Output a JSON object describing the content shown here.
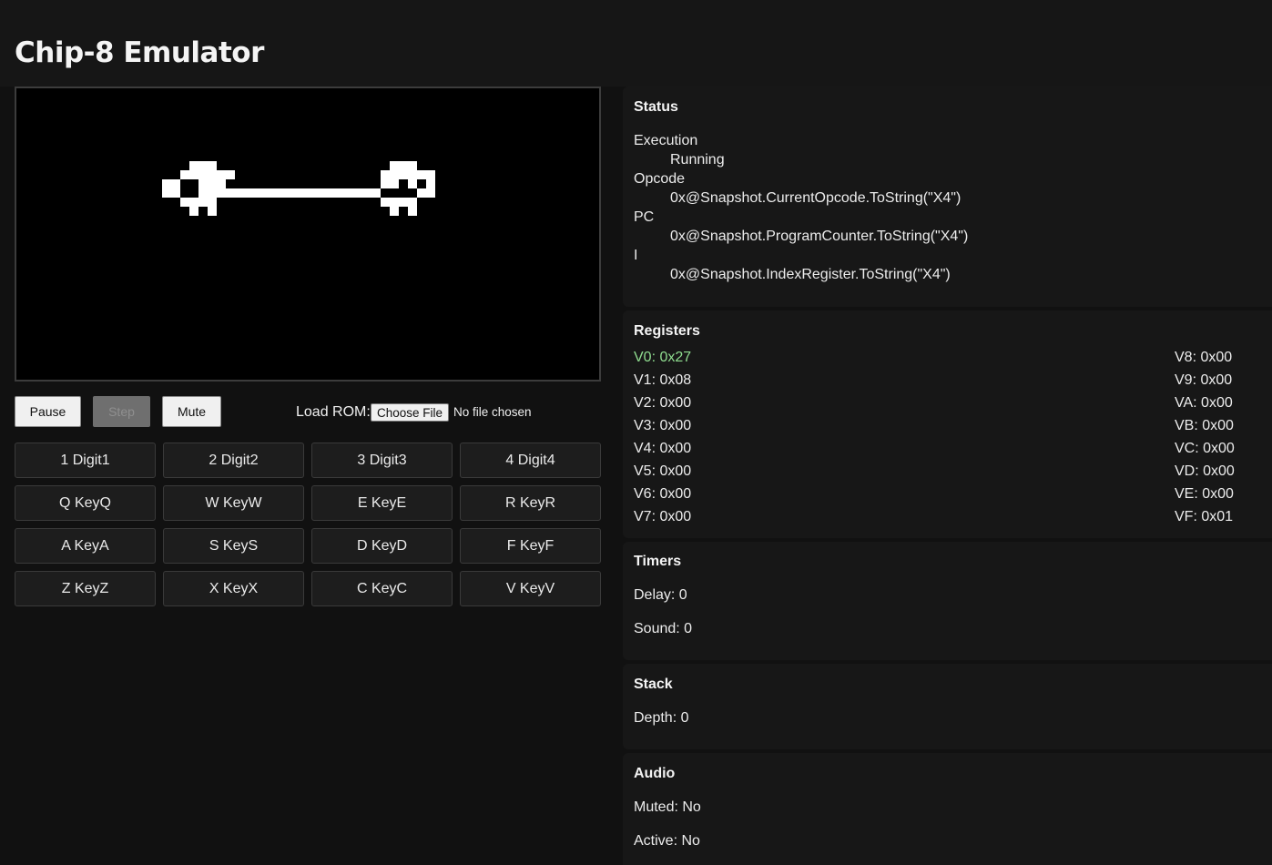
{
  "page": {
    "title": "Chip-8 Emulator"
  },
  "controls": {
    "pause_label": "Pause",
    "step_label": "Step",
    "mute_label": "Mute",
    "load_rom_label": "Load ROM:",
    "choose_file_label": "Choose File",
    "file_status": "No file chosen"
  },
  "keypad": [
    [
      "1 Digit1",
      "2 Digit2",
      "3 Digit3",
      "4 Digit4"
    ],
    [
      "Q KeyQ",
      "W KeyW",
      "E KeyE",
      "R KeyR"
    ],
    [
      "A KeyA",
      "S KeyS",
      "D KeyD",
      "F KeyF"
    ],
    [
      "Z KeyZ",
      "X KeyX",
      "C KeyC",
      "V KeyV"
    ]
  ],
  "status": {
    "title": "Status",
    "execution_label": "Execution",
    "execution_value": "Running",
    "opcode_label": "Opcode",
    "opcode_value": "0x@Snapshot.CurrentOpcode.ToString(\"X4\")",
    "pc_label": "PC",
    "pc_value": "0x@Snapshot.ProgramCounter.ToString(\"X4\")",
    "i_label": "I",
    "i_value": "0x@Snapshot.IndexRegister.ToString(\"X4\")"
  },
  "registers": {
    "title": "Registers",
    "left": [
      "V0: 0x27",
      "V1: 0x08",
      "V2: 0x00",
      "V3: 0x00",
      "V4: 0x00",
      "V5: 0x00",
      "V6: 0x00",
      "V7: 0x00"
    ],
    "right": [
      "V8: 0x00",
      "V9: 0x00",
      "VA: 0x00",
      "VB: 0x00",
      "VC: 0x00",
      "VD: 0x00",
      "VE: 0x00",
      "VF: 0x01"
    ],
    "highlight_color": "#8fdc8f"
  },
  "timers": {
    "title": "Timers",
    "delay": "Delay: 0",
    "sound": "Sound: 0"
  },
  "stack": {
    "title": "Stack",
    "depth": "Depth: 0"
  },
  "audio": {
    "title": "Audio",
    "muted": "Muted: No",
    "active": "Active: No"
  }
}
